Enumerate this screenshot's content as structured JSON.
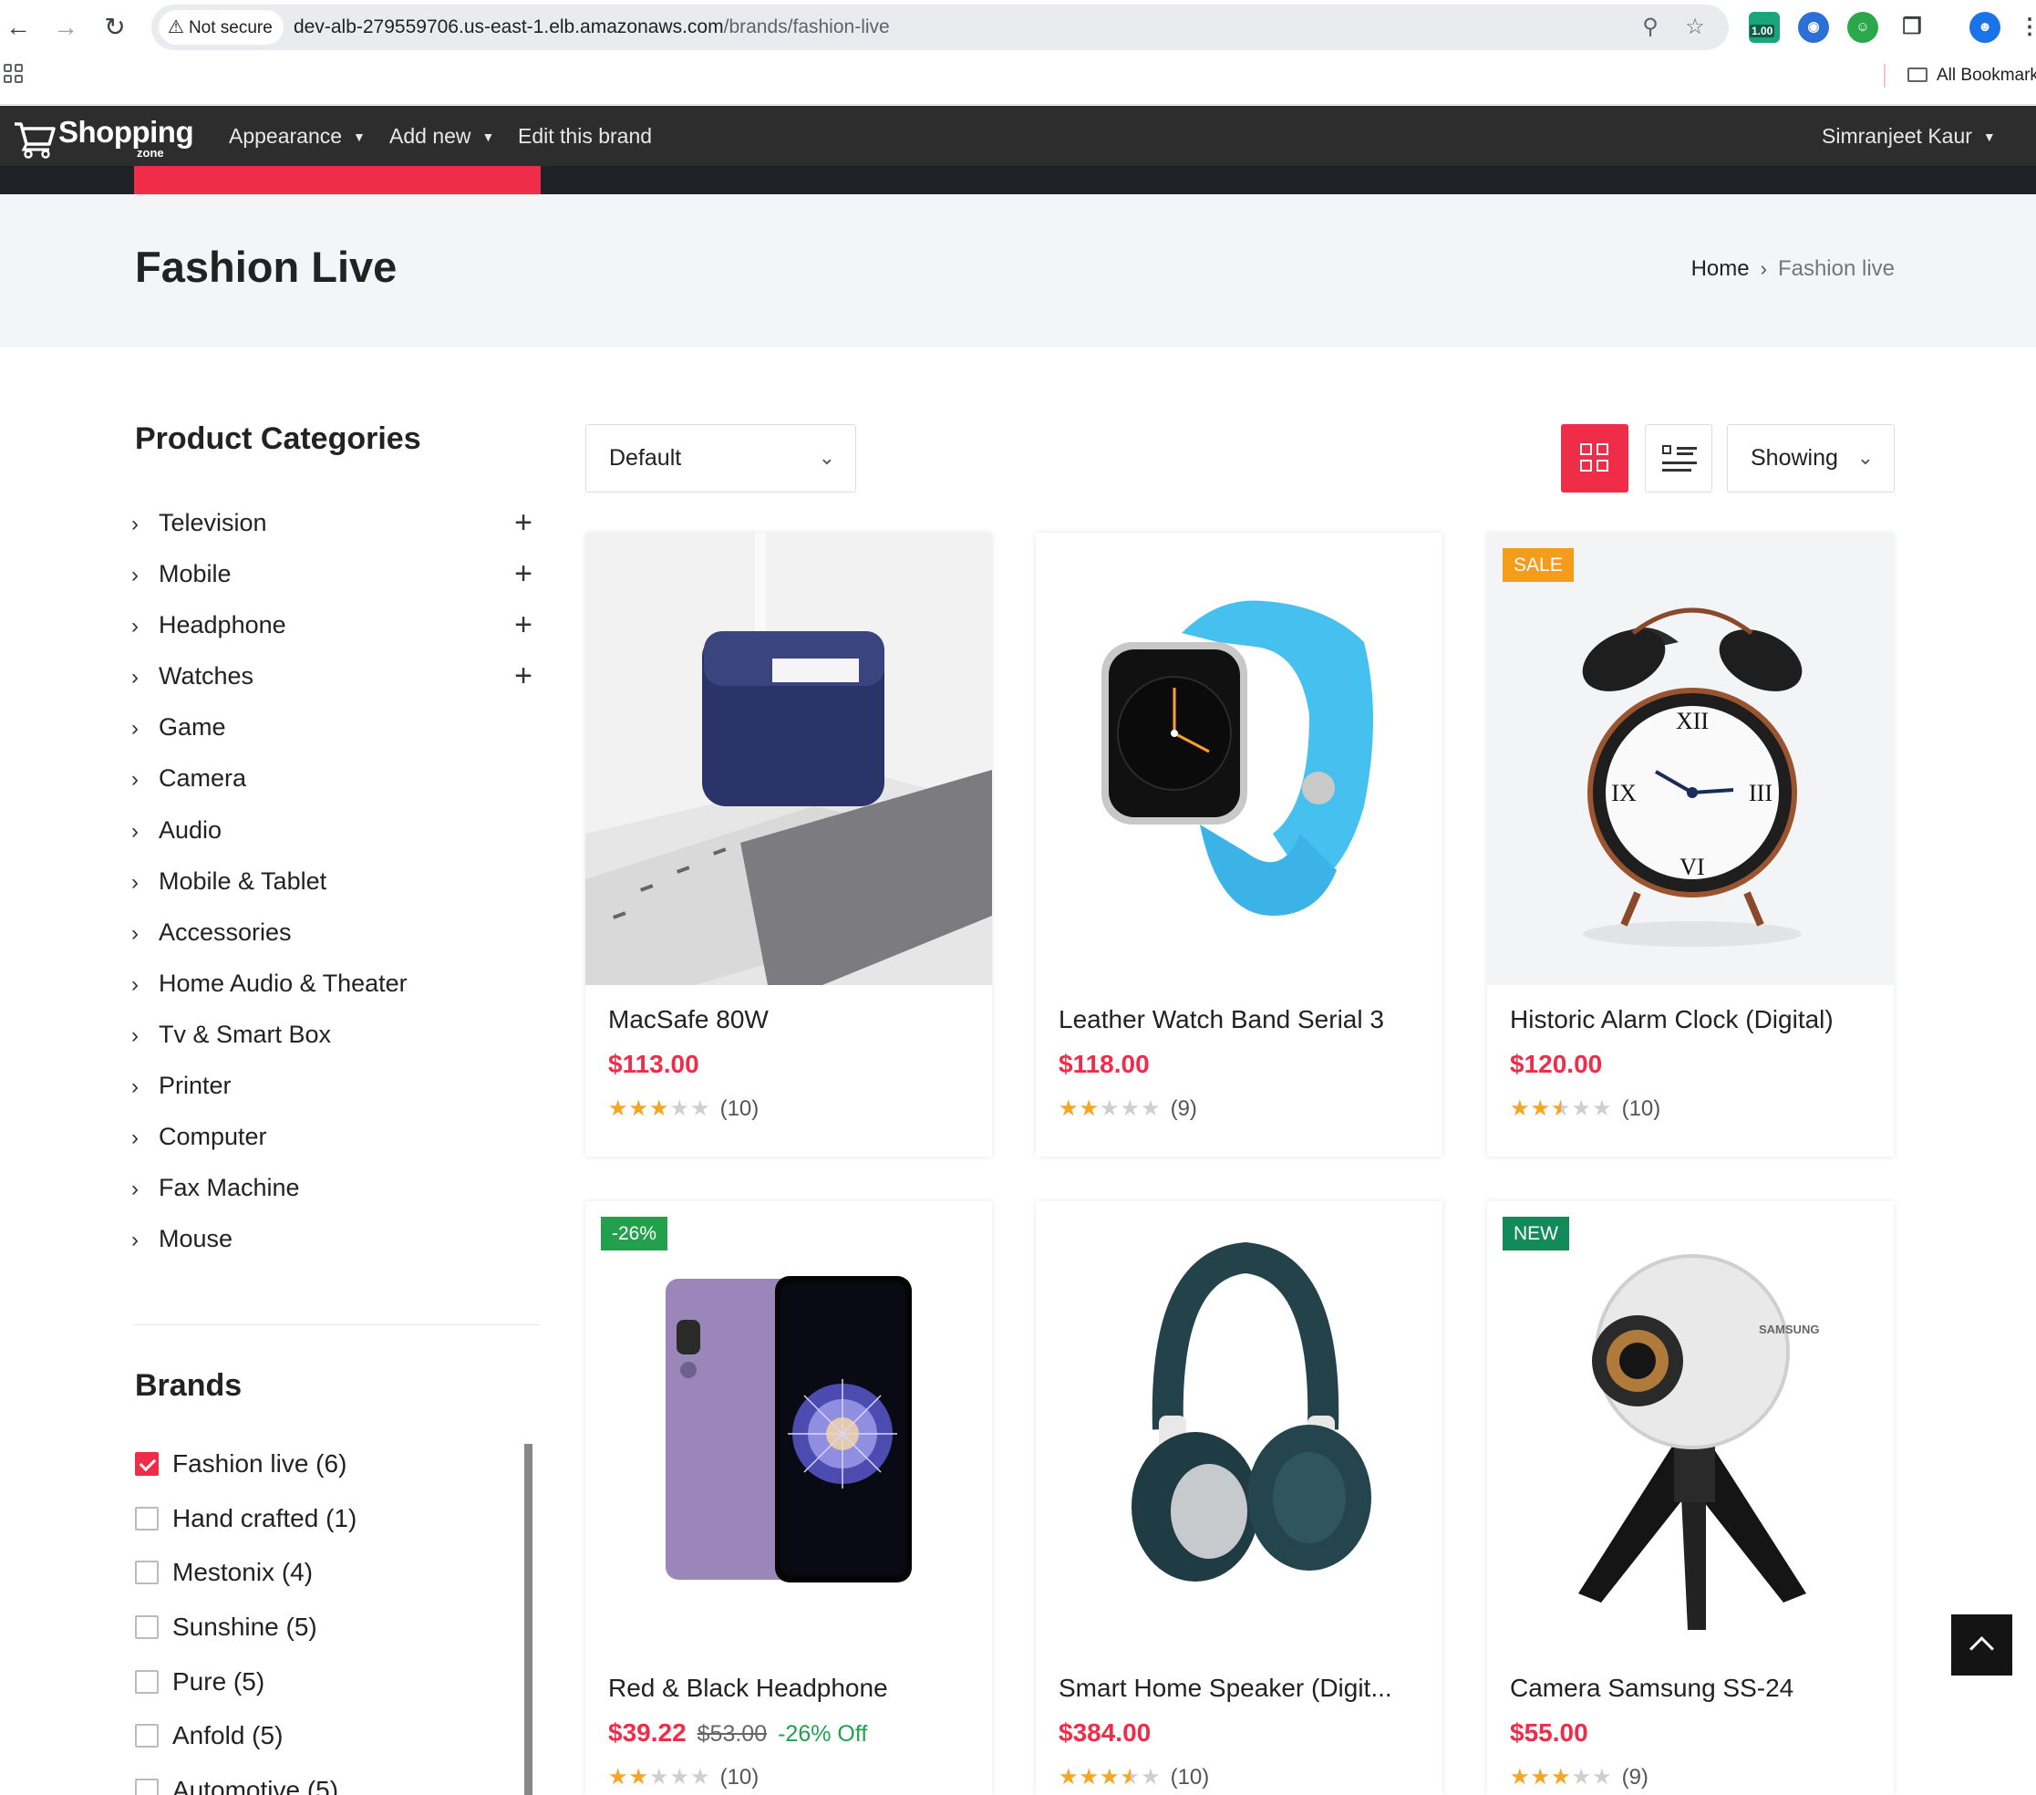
{
  "browser": {
    "not_secure_label": "Not secure",
    "url_host": "dev-alb-279559706.us-east-1.elb.amazonaws.com",
    "url_path": "/brands/fashion-live",
    "extension_badge": "1.00",
    "bookmarks_label": "All Bookmarks"
  },
  "site": {
    "logo_text": "Shopping",
    "logo_sub": "zone",
    "nav": {
      "appearance": "Appearance",
      "add_new": "Add new",
      "edit_brand": "Edit this brand"
    },
    "user_name": "Simranjeet Kaur",
    "accent_color": "#ef2d49"
  },
  "page": {
    "title": "Fashion Live",
    "breadcrumb": {
      "home": "Home",
      "current": "Fashion live"
    }
  },
  "sidebar": {
    "categories_title": "Product Categories",
    "categories": [
      {
        "label": "Television",
        "expandable": true
      },
      {
        "label": "Mobile",
        "expandable": true
      },
      {
        "label": "Headphone",
        "expandable": true
      },
      {
        "label": "Watches",
        "expandable": true
      },
      {
        "label": "Game",
        "expandable": false
      },
      {
        "label": "Camera",
        "expandable": false
      },
      {
        "label": "Audio",
        "expandable": false
      },
      {
        "label": "Mobile & Tablet",
        "expandable": false
      },
      {
        "label": "Accessories",
        "expandable": false
      },
      {
        "label": "Home Audio & Theater",
        "expandable": false
      },
      {
        "label": "Tv & Smart Box",
        "expandable": false
      },
      {
        "label": "Printer",
        "expandable": false
      },
      {
        "label": "Computer",
        "expandable": false
      },
      {
        "label": "Fax Machine",
        "expandable": false
      },
      {
        "label": "Mouse",
        "expandable": false
      }
    ],
    "brands_title": "Brands",
    "brands": [
      {
        "label": "Fashion live (6)",
        "checked": true
      },
      {
        "label": "Hand crafted (1)",
        "checked": false
      },
      {
        "label": "Mestonix (4)",
        "checked": false
      },
      {
        "label": "Sunshine (5)",
        "checked": false
      },
      {
        "label": "Pure (5)",
        "checked": false
      },
      {
        "label": "Anfold (5)",
        "checked": false
      },
      {
        "label": "Automotive (5)",
        "checked": false
      }
    ]
  },
  "toolbar": {
    "sort_value": "Default",
    "showing_label": "Showing"
  },
  "products": [
    {
      "name": "MacSafe 80W",
      "price": "$113.00",
      "rating": 3,
      "count": "(10)",
      "badge": "",
      "image": "charger-image"
    },
    {
      "name": "Leather Watch Band Serial 3",
      "price": "$118.00",
      "rating": 2,
      "count": "(9)",
      "badge": "",
      "image": "smartwatch-image"
    },
    {
      "name": "Historic Alarm Clock (Digital)",
      "price": "$120.00",
      "rating": 2.5,
      "count": "(10)",
      "badge": "SALE",
      "badge_color": "#f59c1a",
      "image": "alarm-clock-image"
    },
    {
      "name": "Red & Black Headphone",
      "price": "$39.22",
      "old_price": "$53.00",
      "discount": "-26% Off",
      "rating": 2,
      "count": "(10)",
      "badge": "-26%",
      "badge_color": "#22a04b",
      "image": "smartphone-image"
    },
    {
      "name": "Smart Home Speaker (Digit...",
      "price": "$384.00",
      "rating": 3.5,
      "count": "(10)",
      "badge": "",
      "image": "headphones-image"
    },
    {
      "name": "Camera Samsung SS-24",
      "price": "$55.00",
      "rating": 3,
      "count": "(9)",
      "badge": "NEW",
      "badge_color": "#128a5a",
      "image": "camera-360-image"
    }
  ]
}
